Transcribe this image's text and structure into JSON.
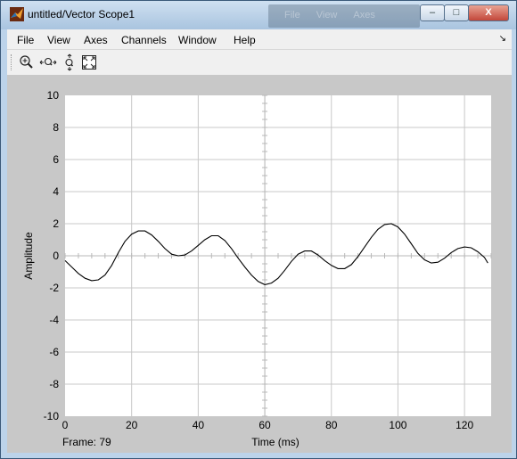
{
  "window": {
    "title": "untitled/Vector Scope1",
    "minimize_label": "–",
    "maximize_label": "□",
    "close_label": "X"
  },
  "menubar": [
    "File",
    "View",
    "Axes",
    "Channels",
    "Window",
    "Help"
  ],
  "toolbar": [
    "zoom-in-icon",
    "zoom-x-icon",
    "zoom-y-icon",
    "fit-to-view-icon"
  ],
  "colors": {
    "plot_bg": "#ffffff",
    "surround": "#c8c8c8",
    "trace": "#000000",
    "grid": "#c8c8c8"
  },
  "scope": {
    "frame_label": "Frame:  79",
    "xlabel": "Time (ms)",
    "ylabel": "Amplitude"
  },
  "chart_data": {
    "type": "line",
    "title": "",
    "xlabel": "Time (ms)",
    "ylabel": "Amplitude",
    "xlim": [
      0,
      128
    ],
    "ylim": [
      -10,
      10
    ],
    "grid": true,
    "x_ticks": [
      0,
      20,
      40,
      60,
      80,
      100,
      120
    ],
    "y_ticks": [
      -10,
      -8,
      -6,
      -4,
      -2,
      0,
      2,
      4,
      6,
      8,
      10
    ],
    "x": [
      0,
      2,
      4,
      6,
      8,
      10,
      12,
      14,
      16,
      18,
      20,
      22,
      24,
      26,
      28,
      30,
      32,
      34,
      36,
      38,
      40,
      42,
      44,
      46,
      48,
      50,
      52,
      54,
      56,
      58,
      60,
      62,
      64,
      66,
      68,
      70,
      72,
      74,
      76,
      78,
      80,
      82,
      84,
      86,
      88,
      90,
      92,
      94,
      96,
      98,
      100,
      102,
      104,
      106,
      108,
      110,
      112,
      114,
      116,
      118,
      120,
      122,
      124,
      126,
      127
    ],
    "series": [
      {
        "values": [
          -0.3,
          -0.7,
          -1.1,
          -1.4,
          -1.55,
          -1.5,
          -1.2,
          -0.6,
          0.2,
          0.9,
          1.35,
          1.55,
          1.55,
          1.3,
          0.9,
          0.45,
          0.1,
          0.0,
          0.05,
          0.3,
          0.65,
          1.0,
          1.25,
          1.25,
          0.95,
          0.45,
          -0.15,
          -0.7,
          -1.2,
          -1.6,
          -1.8,
          -1.7,
          -1.4,
          -0.9,
          -0.35,
          0.1,
          0.3,
          0.3,
          0.05,
          -0.3,
          -0.6,
          -0.8,
          -0.8,
          -0.55,
          -0.05,
          0.55,
          1.15,
          1.65,
          1.95,
          2.0,
          1.8,
          1.35,
          0.75,
          0.15,
          -0.25,
          -0.45,
          -0.4,
          -0.15,
          0.2,
          0.45,
          0.55,
          0.5,
          0.25,
          -0.1,
          -0.45
        ]
      }
    ]
  }
}
